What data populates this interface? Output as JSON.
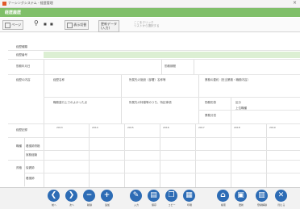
{
  "window": {
    "title": "ナーシングシステム - 経歴管理"
  },
  "screen": {
    "title": "経歴履歴"
  },
  "toolbar": {
    "page_label": "ページ",
    "search_labels": [
      "■",
      "■"
    ],
    "button1_label": "表示切替",
    "button2_label": "更新データ",
    "button2_sub": "(入力)",
    "note_line1": "ここをクリック",
    "note_line2": "リストから選択する"
  },
  "form": {
    "row1_label": "経歴種類",
    "row2_label": "経歴番号",
    "row3_label": "勤務年月日",
    "row3_right": "勤務期間",
    "section_label": "経歴の内容",
    "col_headers": [
      "経歴名称",
      "所属先の施設（部署）名称等",
      "業務の要約（担当業務・職務内容）"
    ],
    "lower_headers": [
      "職務遂行上でのよかった点",
      "所属先の特徴等のうち、特記事項",
      "勤務形態",
      "区分"
    ],
    "extra_labels": [
      "上位職種",
      "業務分担"
    ],
    "history_label": "経歴記録",
    "years": [
      "2013",
      "2014",
      "2015",
      "2016",
      "2017",
      "2018",
      "2019"
    ],
    "cat1_label": "職種",
    "cat1_sub1": "看護師資格",
    "cat1_sub2": "実務経験",
    "cat2_label": "資格",
    "cat2_sub1": "保健師",
    "cat2_sub2": "看護師"
  },
  "bottom_buttons": [
    {
      "label": "前へ",
      "glyph": "❮"
    },
    {
      "label": "次へ",
      "glyph": "❯"
    },
    {
      "label": "削除",
      "glyph": "−"
    },
    {
      "label": "追加",
      "glyph": "+"
    },
    {
      "label": "入力",
      "glyph": "✎"
    },
    {
      "label": "保存",
      "glyph": "▤"
    },
    {
      "label": "コピー",
      "glyph": "❐"
    },
    {
      "label": "印刷",
      "glyph": "▦"
    },
    {
      "label": "検索",
      "glyph": "⌂"
    },
    {
      "label": "更新",
      "glyph": "▣"
    },
    {
      "label": "登録解除",
      "glyph": "▥"
    },
    {
      "label": "閉じる",
      "glyph": "✕"
    }
  ]
}
